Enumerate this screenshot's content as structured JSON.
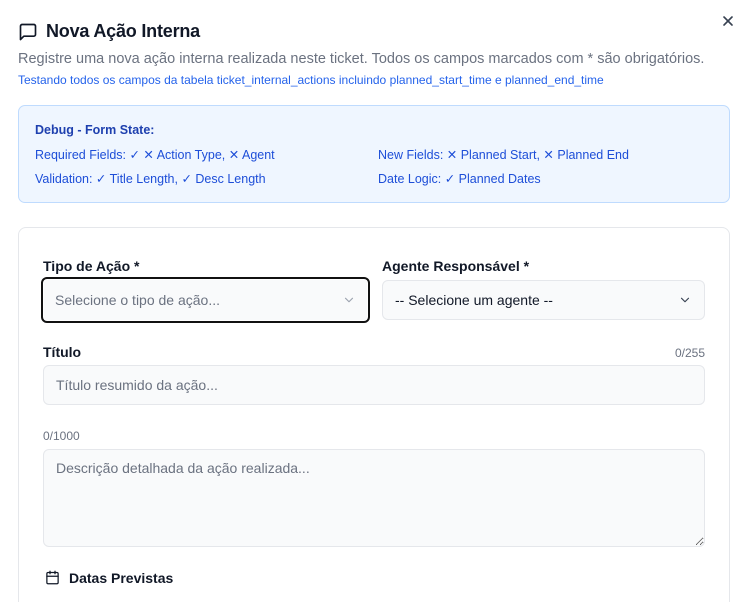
{
  "dialog": {
    "title": "Nova Ação Interna",
    "subtitle": "Registre uma nova ação interna realizada neste ticket. Todos os campos marcados com * são obrigatórios.",
    "test_note": "Testando todos os campos da tabela ticket_internal_actions incluindo planned_start_time e planned_end_time",
    "close_icon": "close-icon",
    "title_icon": "message-square-icon"
  },
  "debug": {
    "title": "Debug - Form State:",
    "required_fields": "Required Fields: ✓ ✕ Action Type, ✕ Agent",
    "validation": "Validation: ✓ Title Length, ✓ Desc Length",
    "new_fields": "New Fields: ✕ Planned Start, ✕ Planned End",
    "date_logic": "Date Logic: ✓ Planned Dates"
  },
  "form": {
    "action_type": {
      "label": "Tipo de Ação *",
      "placeholder": "Selecione o tipo de ação..."
    },
    "agent": {
      "label": "Agente Responsável *",
      "value": "-- Selecione um agente --"
    },
    "title": {
      "label": "Título",
      "counter": "0/255",
      "placeholder": "Título resumido da ação..."
    },
    "description": {
      "counter": "0/1000",
      "placeholder": "Descrição detalhada da ação realizada..."
    },
    "planned_dates": {
      "label": "Datas Previstas",
      "icon": "calendar-icon"
    }
  },
  "colors": {
    "accent_blue": "#2563eb",
    "debug_bg": "#eff6ff",
    "debug_border": "#bfdbfe",
    "focus_ring": "#111111"
  }
}
